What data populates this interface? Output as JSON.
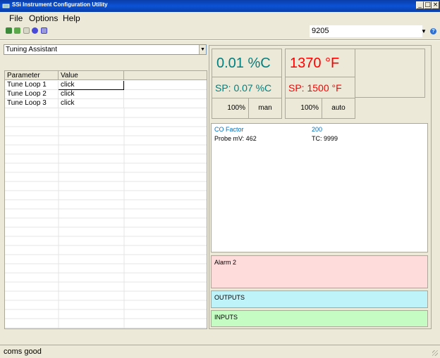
{
  "window": {
    "title": "SSi Instrument Configuration Utility"
  },
  "menu": {
    "file": "File",
    "options": "Options",
    "help": "Help"
  },
  "toolbar": {
    "icons": [
      "link-icon",
      "hand-icon",
      "bulb-icon",
      "globe-icon",
      "chart-icon"
    ],
    "instrument_selected": "9205"
  },
  "left_panel": {
    "mode_selected": "Tuning Assistant",
    "columns": [
      "Parameter",
      "Value"
    ],
    "rows": [
      {
        "parameter": "Tune Loop 1",
        "value": "click"
      },
      {
        "parameter": "Tune Loop 2",
        "value": "click"
      },
      {
        "parameter": "Tune Loop 3",
        "value": "click"
      }
    ]
  },
  "loops": [
    {
      "pv": "0.01 %C",
      "sp": "SP: 0.07 %C",
      "output": "100%",
      "mode": "man",
      "color": "#008080"
    },
    {
      "pv": "1370 °F",
      "sp": "SP: 1500 °F",
      "output": "100%",
      "mode": "auto",
      "color": "#ff0000"
    }
  ],
  "info": {
    "co_factor_label": "CO Factor",
    "co_factor_value": "200",
    "probe_mv": "Probe mV: 462",
    "tc": "TC: 9999",
    "accent": "#0070c0"
  },
  "sections": {
    "alarm": "Alarm 2",
    "outputs": "OUTPUTS",
    "inputs": "INPUTS"
  },
  "status": {
    "text": "coms good"
  }
}
